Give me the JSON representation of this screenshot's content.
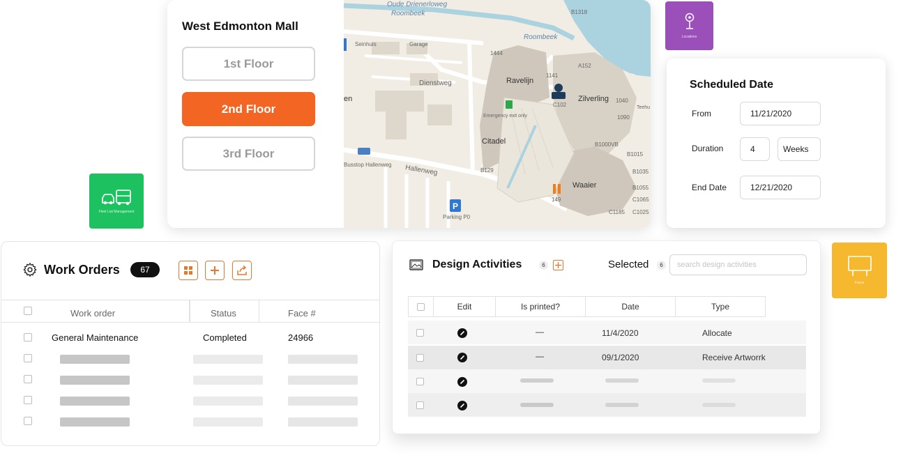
{
  "floor_selector": {
    "title": "West Edmonton Mall",
    "floors": [
      {
        "label": "1st Floor",
        "active": false
      },
      {
        "label": "2nd Floor",
        "active": true
      },
      {
        "label": "3rd Floor",
        "active": false
      }
    ],
    "active_color": "#f26522"
  },
  "map": {
    "labels": {
      "oude_drienerloweg": "Oude Drienerloweg",
      "roombeek_1": "Roombeek",
      "roombeek_2": "Roombeek",
      "seinhuis": "Seinhuis",
      "garage": "Garage",
      "dienstweg": "Dienstweg",
      "ravelijn": "Ravelijn",
      "zilverling": "Zilverling",
      "citadel": "Citadel",
      "waaier": "Waaier",
      "hallenweg": "Hallenweg",
      "busstop": "Busstop Hallenweg",
      "parking": "Parking P0",
      "emergency_exit": "Emergency exit only",
      "teehuis": "Teehu",
      "b1318": "B1318",
      "a152": "A152",
      "c102": "C102",
      "b1444": "1444",
      "b1141": "1141",
      "b1040": "1040",
      "b1090": "1090",
      "b1000vb": "B1000VB",
      "b1015": "B1015",
      "b1035": "B1035",
      "b1055": "B1055",
      "c1185": "C1185",
      "c1065": "C1065",
      "c1025": "C1025",
      "b129": "B129",
      "b149": "149",
      "en": "en"
    }
  },
  "tiles": {
    "locations": {
      "caption": "Locations",
      "color": "#9b4fb8",
      "icon": "location-pin-icon"
    },
    "fleet": {
      "caption": "Fleet List Management",
      "color": "#1ec15f",
      "icon": "vehicles-icon"
    },
    "faces": {
      "caption": "Faces",
      "color": "#f5b82e",
      "icon": "billboard-icon"
    }
  },
  "schedule": {
    "title": "Scheduled Date",
    "from_label": "From",
    "from_value": "11/21/2020",
    "duration_label": "Duration",
    "duration_value": "4",
    "duration_unit": "Weeks",
    "end_label": "End Date",
    "end_value": "12/21/2020"
  },
  "work_orders": {
    "title": "Work Orders",
    "count": "67",
    "accent": "#e8772e",
    "columns": [
      "Work order",
      "Status",
      "Face #"
    ],
    "row": {
      "work_order": "General Maintenance",
      "status": "Completed",
      "face": "24966"
    }
  },
  "design_activities": {
    "title": "Design Activities",
    "count": "6",
    "selected_label": "Selected",
    "selected_count": "6",
    "search_placeholder": "search design activities",
    "columns": [
      "Edit",
      "Is printed?",
      "Date",
      "Type"
    ],
    "rows": [
      {
        "printed": "—",
        "date": "11/4/2020",
        "type": "Allocate"
      },
      {
        "printed": "—",
        "date": "09/1/2020",
        "type": "Receive Artworrk"
      }
    ]
  }
}
